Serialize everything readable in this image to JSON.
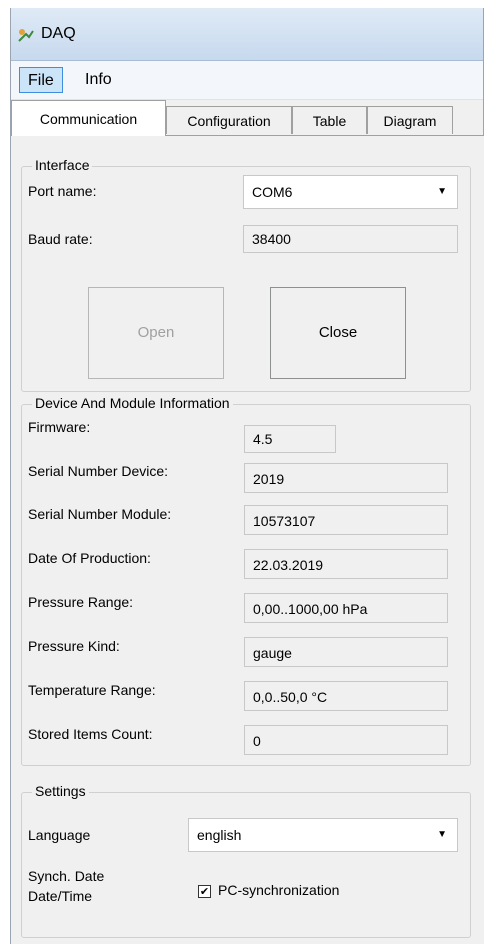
{
  "window": {
    "title": "DAQ",
    "icon": "app-icon"
  },
  "menu": {
    "file": "File",
    "info": "Info"
  },
  "tabs": {
    "communication": "Communication",
    "configuration": "Configuration",
    "table": "Table",
    "diagram": "Diagram"
  },
  "interface": {
    "title": "Interface",
    "port_label": "Port name:",
    "port_value": "COM6",
    "baud_label": "Baud rate:",
    "baud_value": "38400",
    "open": "Open",
    "close": "Close"
  },
  "device": {
    "title": "Device And Module Information",
    "firmware_label": "Firmware:",
    "firmware_value": "4.5",
    "serial_device_label": "Serial Number Device:",
    "serial_device_value": "2019",
    "serial_module_label": "Serial Number Module:",
    "serial_module_value": "10573107",
    "date_label": "Date Of Production:",
    "date_value": "22.03.2019",
    "pressure_range_label": "Pressure Range:",
    "pressure_range_value": "0,00..1000,00 hPa",
    "pressure_kind_label": "Pressure Kind:",
    "pressure_kind_value": "gauge",
    "temp_range_label": "Temperature Range:",
    "temp_range_value": "0,0..50,0 °C",
    "stored_label": "Stored Items Count:",
    "stored_value": "0"
  },
  "settings": {
    "title": "Settings",
    "language_label": "Language",
    "language_value": "english",
    "sync_label_1": "Synch. Date",
    "sync_label_2": "Date/Time",
    "sync_checkbox_label": "PC-synchronization",
    "sync_checked": true
  },
  "colors": {
    "menu_active_bg": "#cce4f7",
    "menu_active_border": "#3d8ee0",
    "titlebar": "#c7d9ee"
  }
}
